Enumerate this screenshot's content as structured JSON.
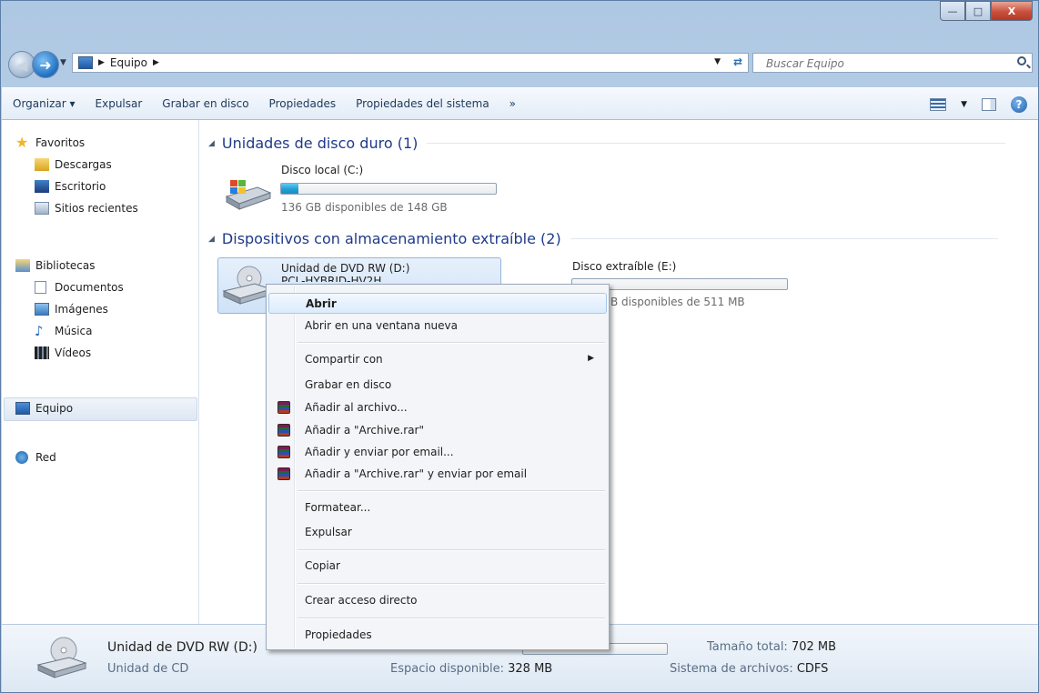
{
  "window": {
    "caption": {
      "minimize": "—",
      "maximize": "□",
      "close": "X"
    }
  },
  "addressbar": {
    "crumbs": [
      "Equipo"
    ],
    "search_placeholder": "Buscar Equipo"
  },
  "toolbar": {
    "items": [
      "Organizar ▾",
      "Expulsar",
      "Grabar en disco",
      "Propiedades",
      "Propiedades del sistema",
      "»"
    ]
  },
  "navpane": {
    "favorites_header": "Favoritos",
    "favorites": [
      "Descargas",
      "Escritorio",
      "Sitios recientes"
    ],
    "libraries_header": "Bibliotecas",
    "libraries": [
      "Documentos",
      "Imágenes",
      "Música",
      "Vídeos"
    ],
    "computer": "Equipo",
    "network": "Red"
  },
  "content": {
    "group_hdd": "Unidades de disco duro (1)",
    "group_removable": "Dispositivos con almacenamiento extraíble (2)",
    "drive_c": {
      "name": "Disco local (C:)",
      "space": "136 GB disponibles de 148 GB",
      "used_fraction": 0.08
    },
    "drive_d": {
      "name": "Unidad de DVD RW (D:)",
      "label_partial": "PCL-HYBRID-HV2H"
    },
    "drive_e": {
      "name": "Disco extraíble (E:)",
      "space_partial": "B disponibles de 511 MB",
      "used_fraction": 0.0
    }
  },
  "context_menu": {
    "items": [
      {
        "label": "Abrir",
        "bold": true,
        "highlight": true
      },
      {
        "label": "Abrir en una ventana nueva"
      },
      {
        "label": "Compartir con",
        "submenu": true
      },
      {
        "label": "Grabar en disco"
      },
      {
        "label": "Añadir al archivo...",
        "icon": "winrar-icon"
      },
      {
        "label": "Añadir a \"Archive.rar\"",
        "icon": "winrar-icon"
      },
      {
        "label": "Añadir y enviar por email...",
        "icon": "winrar-icon"
      },
      {
        "label": "Añadir a \"Archive.rar\" y enviar por email",
        "icon": "winrar-icon"
      },
      {
        "label": "Formatear..."
      },
      {
        "label": "Expulsar"
      },
      {
        "label": "Copiar"
      },
      {
        "label": "Crear acceso directo"
      },
      {
        "label": "Propiedades"
      }
    ]
  },
  "details": {
    "name": "Unidad de DVD RW (D:)",
    "type": "Unidad de CD",
    "free_label": "Espacio disponible:",
    "free_value": "328 MB",
    "total_label": "Tamaño total:",
    "total_value": "702 MB",
    "fs_label": "Sistema de archivos:",
    "fs_value": "CDFS"
  }
}
